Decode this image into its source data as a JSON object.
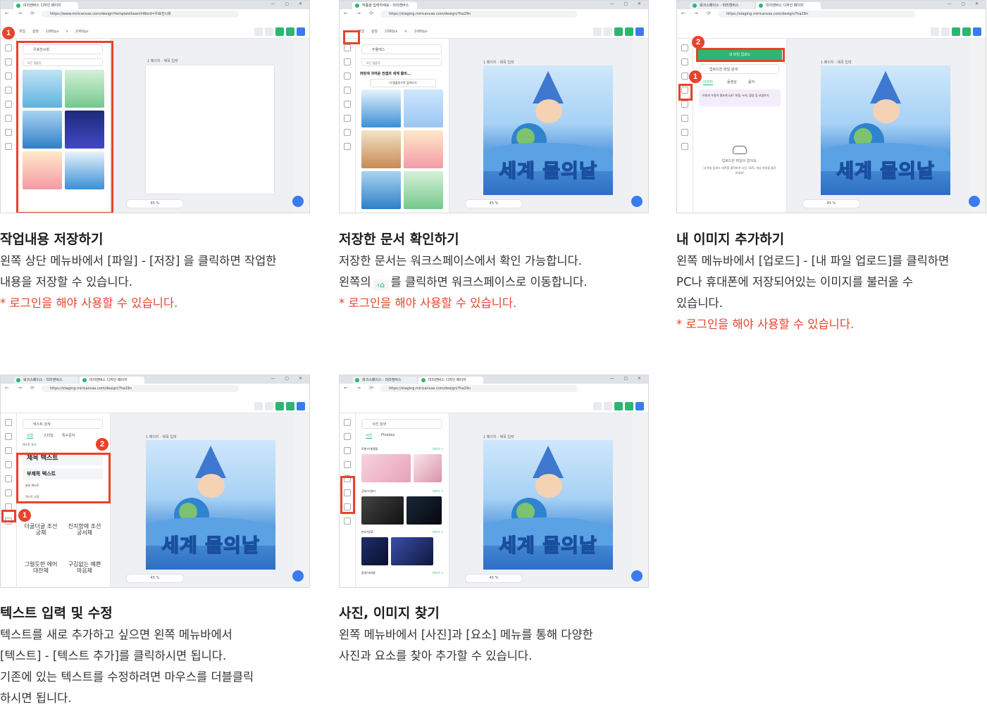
{
  "sections": [
    {
      "title": "작업내용 저장하기",
      "body": [
        "왼쪽 상단 메뉴바에서 [파일] - [저장] 을 클릭하면 작업한",
        "내용을 저장할 수 있습니다."
      ],
      "note": "* 로그인을 해야 사용할 수 있습니다."
    },
    {
      "title": "저장한 문서 확인하기",
      "body": [
        "저장한 문서는 워크스페이스에서 확인 가능합니다."
      ],
      "body2_before": "왼쪽의",
      "body2_icon": "home-icon",
      "body2_after": "를 클릭하면 워크스페이스로 이동합니다.",
      "note": "* 로그인을 해야 사용할 수 있습니다."
    },
    {
      "title": "내 이미지 추가하기",
      "body": [
        "왼쪽 메뉴바에서 [업로드] - [내 파일 업로드]를 클릭하면",
        "PC나 휴대폰에 저장되어있는 이미지를 불러올 수",
        "있습니다."
      ],
      "note": "* 로그인을 해야 사용할 수 있습니다."
    },
    {
      "title": "텍스트 입력 및 수정",
      "body": [
        "텍스트를 새로 추가하고 싶으면 왼쪽 메뉴바에서",
        "[텍스트] - [텍스트 추가]를 클릭하시면 됩니다.",
        "기존에 있는 텍스트를 수정하려면 마우스를 더블클릭",
        "하시면 됩니다."
      ]
    },
    {
      "title": "사진, 이미지 찾기",
      "body": [
        "왼쪽 메뉴바에서 [사진]과 [요소] 메뉴를 통해 다양한",
        "사진과 요소를 찾아 추가할 수 있습니다."
      ]
    }
  ],
  "screens": {
    "s1": {
      "tabs": [
        "미리캔버스 디자인 페이지"
      ],
      "url": "https://www.miricanvas.com/design?templateSearchWord=우표전시회",
      "menu": "파일   설정   1080px × 1080px",
      "search": "우표전시회",
      "select": "모든 템플릿",
      "page_label": "1 페이지 - 제목 입력",
      "zoom": "45 %",
      "badges": [
        "1"
      ]
    },
    "s2": {
      "tabs": [
        "작품을 입력하세요 - 미리캔버스"
      ],
      "url": "https://staging.miricanvas.com/design/?ha29n",
      "menu": "파일   설정   1080px × 1080px",
      "search": "두물레스",
      "select": "모든 템플릿",
      "result_title": "파란색 귀여운 컨셉의 세계 물의...",
      "template_btn": "이 템플릿으로 덮어쓰기",
      "page_label": "1 페이지 - 제목 입력",
      "poster_title": "세계 물의날",
      "zoom": "45 %"
    },
    "s3": {
      "tabs": [
        "워크스페이스 - 미리캔버스",
        "미리캔버스 디자인 페이지"
      ],
      "url": "https://staging.miricanvas.com/design/?ha29n",
      "upload_btn": "내 파일 업로드",
      "search": "업로드한 파일 검색",
      "panel_tabs": [
        "이미지",
        "동영상",
        "음악"
      ],
      "promo": "이미지 수정이 필요하나요? 보정, 누끼, 합성 등 요청하기",
      "empty": "업로드한 파일이 없어요.",
      "empty_sub": "내 파일 업로드 버튼을 클릭하여 사진, SVG, 영상 파일을 올려보세요!",
      "page_label": "1 페이지 - 제목 입력",
      "poster_title": "세계 물의날",
      "zoom": "45 %",
      "badges": [
        "1",
        "2"
      ]
    },
    "s4": {
      "tabs": [
        "워크스페이스 - 미리캔버스",
        "미리캔버스 디자인 페이지"
      ],
      "url": "https://staging.miricanvas.com/design/?ha29n",
      "search": "텍스트 검색",
      "panel_tabs": [
        "조합",
        "스타일",
        "특수문자"
      ],
      "add_label": "텍스트 추가",
      "heading": "제목 텍스트",
      "subheading": "부제목 텍스트",
      "bodytext": "본문 텍스트",
      "combo_label": "텍스트 조합",
      "samples": [
        "더굴더굴 조선궁체",
        "진지함에 조선궁서체",
        "그럴듯한 에어 대잔체",
        "구김없는 예쁜 마음체"
      ],
      "page_label": "1 페이지 - 제목 입력",
      "poster_title": "세계 물의날",
      "zoom": "45 %",
      "badges": [
        "1",
        "2"
      ]
    },
    "s5": {
      "tabs": [
        "워크스페이스 - 미리캔버스",
        "미리캔버스 디자인 페이지"
      ],
      "url": "https://staging.miricanvas.com/design/?ha29n",
      "search": "사진 검색",
      "panel_tabs": [
        "사진",
        "Pixabay"
      ],
      "categories": [
        "로맨스/계절들",
        "공포/스릴러",
        "판타지/SF",
        "중세/사대물"
      ],
      "more": "더보기 >",
      "page_label": "1 페이지 - 제목 입력",
      "poster_title": "세계 물의날",
      "zoom": "45 %"
    }
  },
  "colors": {
    "accent": "#e8432b",
    "brand_green": "#2bb673",
    "note_red": "#e8432b"
  }
}
